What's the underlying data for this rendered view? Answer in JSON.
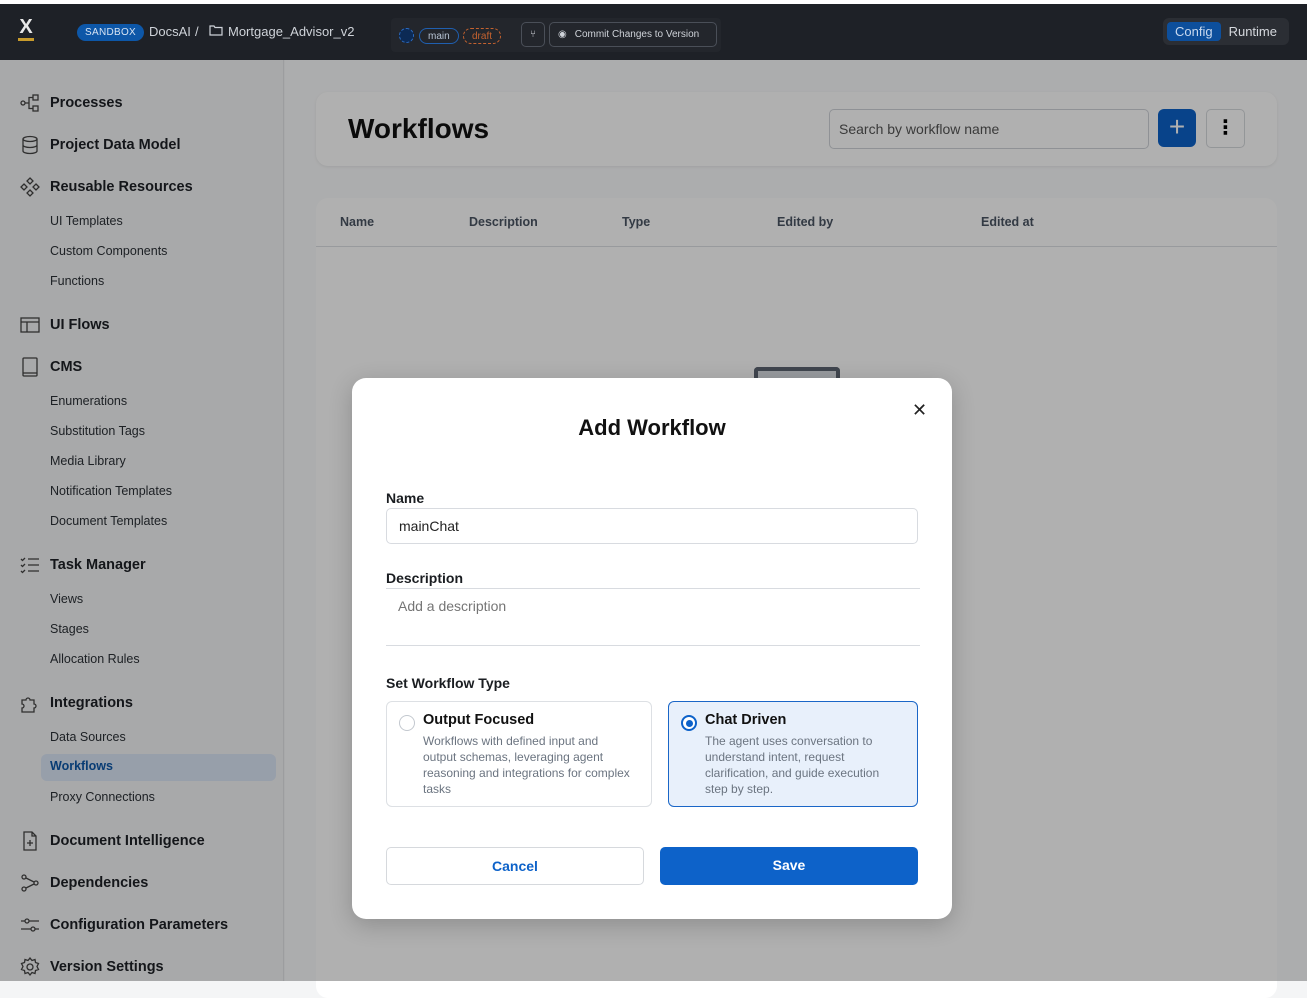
{
  "topbar": {
    "logo": "X",
    "env_badge": "SANDBOX",
    "project": "DocsAI",
    "separator": "/",
    "file": "Mortgage_Advisor_v2",
    "branch": "main",
    "status": "draft",
    "commit_label": "Commit Changes to Version",
    "mode_config": "Config",
    "mode_runtime": "Runtime"
  },
  "sidebar": {
    "items": [
      {
        "label": "Processes",
        "icon": "processes-icon"
      },
      {
        "label": "Project Data Model",
        "icon": "database-icon"
      },
      {
        "label": "Reusable Resources",
        "icon": "resources-icon",
        "children": [
          "UI Templates",
          "Custom Components",
          "Functions"
        ]
      },
      {
        "label": "UI Flows",
        "icon": "layout-icon"
      },
      {
        "label": "CMS",
        "icon": "book-icon",
        "children": [
          "Enumerations",
          "Substitution Tags",
          "Media Library",
          "Notification Templates",
          "Document Templates"
        ]
      },
      {
        "label": "Task Manager",
        "icon": "checklist-icon",
        "children": [
          "Views",
          "Stages",
          "Allocation Rules"
        ]
      },
      {
        "label": "Integrations",
        "icon": "puzzle-icon",
        "children": [
          "Data Sources",
          "Workflows",
          "Proxy Connections"
        ]
      },
      {
        "label": "Document Intelligence",
        "icon": "document-icon"
      },
      {
        "label": "Dependencies",
        "icon": "graph-icon"
      },
      {
        "label": "Configuration Parameters",
        "icon": "sliders-icon"
      },
      {
        "label": "Version Settings",
        "icon": "gear-icon"
      }
    ],
    "active": "Workflows"
  },
  "page": {
    "title": "Workflows",
    "search_placeholder": "Search by workflow name",
    "columns": [
      "Name",
      "Description",
      "Type",
      "Edited by",
      "Edited at"
    ]
  },
  "modal": {
    "title": "Add Workflow",
    "name_label": "Name",
    "name_value": "mainChat",
    "description_label": "Description",
    "description_placeholder": "Add a description",
    "type_label": "Set Workflow Type",
    "options": [
      {
        "title": "Output Focused",
        "desc": "Workflows with defined input and output schemas, leveraging agent reasoning and integrations for complex tasks",
        "selected": false
      },
      {
        "title": "Chat Driven",
        "desc": "The agent uses conversation to understand intent, request clarification, and guide execution step by step.",
        "selected": true
      }
    ],
    "cancel": "Cancel",
    "save": "Save"
  },
  "colors": {
    "accent": "#0d62c9",
    "topbar": "#1e2127"
  }
}
